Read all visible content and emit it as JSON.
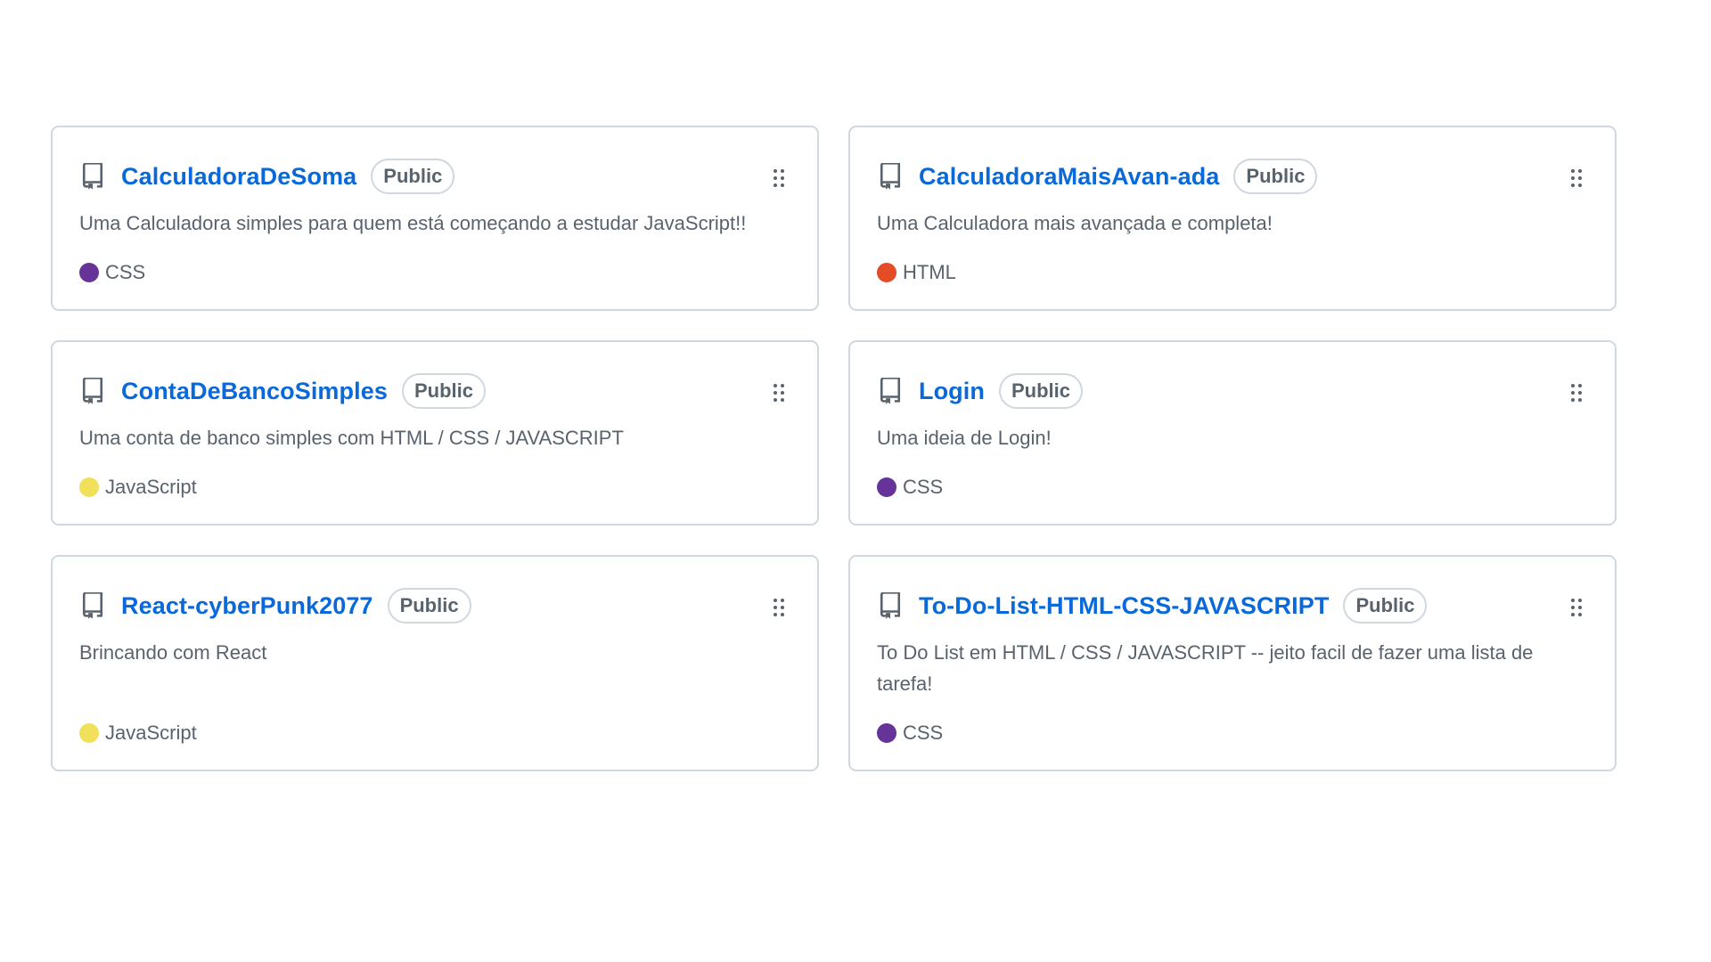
{
  "repos": [
    {
      "name": "CalculadoraDeSoma",
      "visibility": "Public",
      "description": "Uma Calculadora simples para quem está começando a estudar JavaScript!!",
      "language": "CSS",
      "language_color": "#663399"
    },
    {
      "name": "CalculadoraMaisAvan-ada",
      "visibility": "Public",
      "description": "Uma Calculadora mais avançada e completa!",
      "language": "HTML",
      "language_color": "#e34c26"
    },
    {
      "name": "ContaDeBancoSimples",
      "visibility": "Public",
      "description": "Uma conta de banco simples com HTML / CSS / JAVASCRIPT",
      "language": "JavaScript",
      "language_color": "#f1e05a"
    },
    {
      "name": "Login",
      "visibility": "Public",
      "description": "Uma ideia de Login!",
      "language": "CSS",
      "language_color": "#663399"
    },
    {
      "name": "React-cyberPunk2077",
      "visibility": "Public",
      "description": "Brincando com React",
      "language": "JavaScript",
      "language_color": "#f1e05a"
    },
    {
      "name": "To-Do-List-HTML-CSS-JAVASCRIPT",
      "visibility": "Public",
      "description": "To Do List em HTML / CSS / JAVASCRIPT -- jeito facil de fazer uma lista de tarefa!",
      "language": "CSS",
      "language_color": "#663399"
    }
  ],
  "icons": {
    "repo": "repo-icon",
    "drag": "drag-handle-icon"
  }
}
